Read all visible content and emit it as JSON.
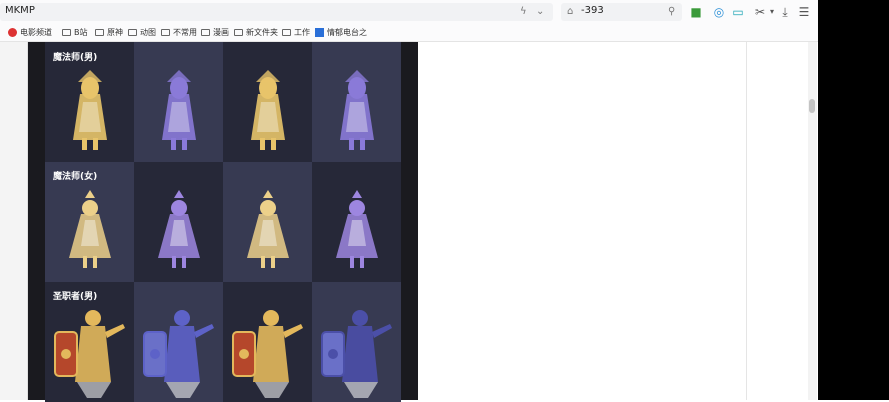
{
  "browser": {
    "address_text": "MKMP",
    "search_text": "-393"
  },
  "bookmarks": [
    {
      "label": "电影频道",
      "icon": "red-dot"
    },
    {
      "label": "B站",
      "icon": "folder"
    },
    {
      "label": "原神",
      "icon": "folder"
    },
    {
      "label": "动图",
      "icon": "folder"
    },
    {
      "label": "不常用",
      "icon": "folder"
    },
    {
      "label": "漫画",
      "icon": "folder"
    },
    {
      "label": "新文件夹",
      "icon": "folder"
    },
    {
      "label": "工作",
      "icon": "folder"
    },
    {
      "label": "情郁电台之",
      "icon": "blue-doc"
    }
  ],
  "gallery": {
    "rows": [
      {
        "label": "魔法师(男)",
        "sprite_colors": [
          "#e8c46a",
          "#8a7ad8",
          "#e8c46a",
          "#8a7ad8"
        ]
      },
      {
        "label": "魔法师(女)",
        "sprite_colors": [
          "#ecd08a",
          "#9d86e0",
          "#ecd08a",
          "#9d86e0"
        ]
      },
      {
        "label": "圣职者(男)",
        "sprite_colors": [
          "#e3b85c",
          "#5d62c8",
          "#e3b85c",
          "#4b4fa8"
        ]
      }
    ]
  },
  "colors": {
    "panel_bg": "#1a1a1f",
    "cell_dark": "#262838",
    "cell_light": "#373a52"
  }
}
